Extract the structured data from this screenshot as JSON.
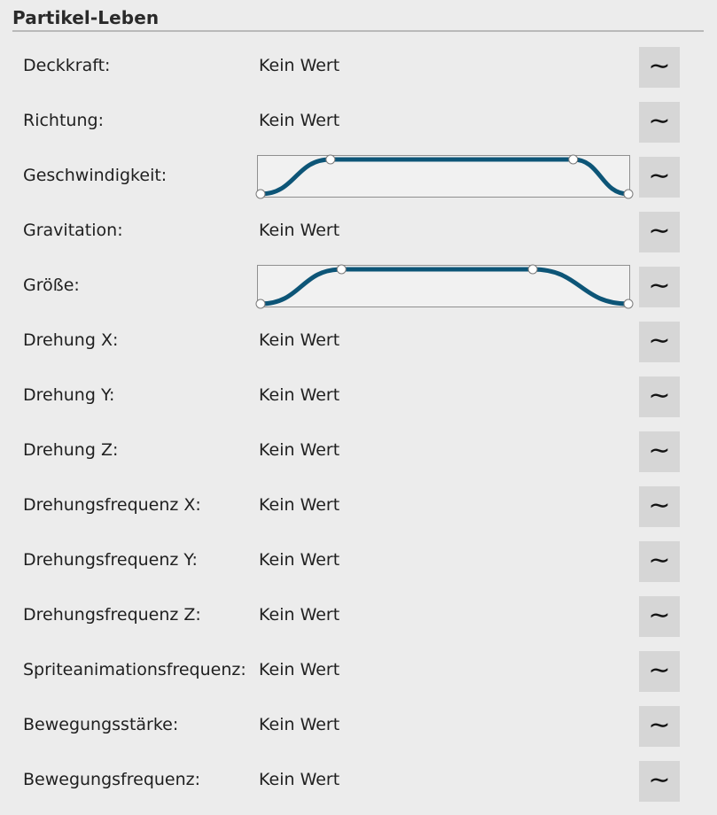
{
  "section": {
    "title": "Partikel-Leben"
  },
  "button_icon_glyph": "∼",
  "accent_color": "#0d5577",
  "rows": [
    {
      "label": "Deckkraft:",
      "value": "Kein Wert"
    },
    {
      "label": "Richtung:",
      "value": "Kein Wert"
    },
    {
      "label": "Geschwindigkeit:",
      "value": null
    },
    {
      "label": "Gravitation:",
      "value": "Kein Wert"
    },
    {
      "label": "Größe:",
      "value": null
    },
    {
      "label": "Drehung X:",
      "value": "Kein Wert"
    },
    {
      "label": "Drehung Y:",
      "value": "Kein Wert"
    },
    {
      "label": "Drehung Z:",
      "value": "Kein Wert"
    },
    {
      "label": "Drehungsfrequenz X:",
      "value": "Kein Wert"
    },
    {
      "label": "Drehungsfrequenz Y:",
      "value": "Kein Wert"
    },
    {
      "label": "Drehungsfrequenz Z:",
      "value": "Kein Wert"
    },
    {
      "label": "Spriteanimationsfrequenz:",
      "value": "Kein Wert"
    },
    {
      "label": "Bewegungsstärke:",
      "value": "Kein Wert"
    },
    {
      "label": "Bewegungsfrequenz:",
      "value": "Kein Wert"
    }
  ],
  "curves": {
    "speed": {
      "row": 2,
      "keys": [
        {
          "t": 0.0,
          "v": 0.0
        },
        {
          "t": 0.19,
          "v": 1.0
        },
        {
          "t": 0.85,
          "v": 1.0
        },
        {
          "t": 1.0,
          "v": 0.0
        }
      ]
    },
    "size": {
      "row": 4,
      "keys": [
        {
          "t": 0.0,
          "v": 0.0
        },
        {
          "t": 0.22,
          "v": 1.0
        },
        {
          "t": 0.74,
          "v": 1.0
        },
        {
          "t": 1.0,
          "v": 0.0
        }
      ]
    }
  }
}
